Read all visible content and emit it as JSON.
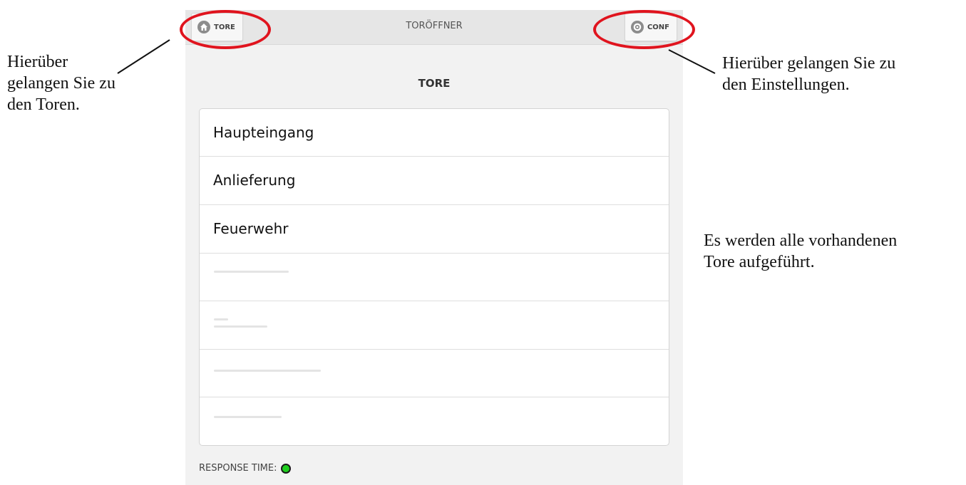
{
  "app": {
    "title": "TORÖFFNER",
    "nav_left": {
      "label": "TORE",
      "icon": "home-icon"
    },
    "nav_right": {
      "label": "CONF",
      "icon": "gear-icon"
    },
    "section_title": "TORE",
    "gates": [
      "Haupteingang",
      "Anlieferung",
      "Feuerwehr"
    ],
    "status": {
      "label": "RESPONSE TIME:",
      "color": "#1fcf1f"
    }
  },
  "annotations": {
    "left_note": [
      "Hierüber",
      "gelangen Sie zu",
      "den Toren."
    ],
    "right_note": [
      "Hierüber gelangen Sie zu",
      "den Einstellungen."
    ],
    "list_note": [
      "Es werden alle vorhandenen",
      "Tore aufgeführt."
    ],
    "highlight_color": "#e0141e"
  }
}
